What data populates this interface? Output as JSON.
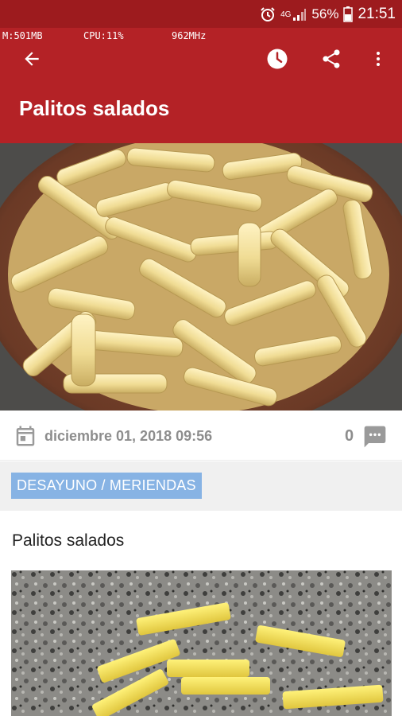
{
  "status_bar": {
    "debug": {
      "mem": "M:501MB",
      "cpu": "CPU:11%",
      "freq": "962MHz"
    },
    "network": "4G",
    "battery": "56%",
    "time": "21:51"
  },
  "toolbar": {
    "back_icon": "arrow-left-icon",
    "clock_icon": "clock-icon",
    "share_icon": "share-icon",
    "more_icon": "more-vertical-icon",
    "title": "Palitos salados"
  },
  "hero": {
    "alt": "Bowl of salty sticks"
  },
  "meta": {
    "date": "diciembre 01, 2018 09:56",
    "comments": "0",
    "calendar_icon": "calendar-icon",
    "comment_icon": "comment-icon"
  },
  "category": {
    "label": "DESAYUNO / MERIENDAS"
  },
  "post": {
    "text": "Palitos salados"
  },
  "colors": {
    "status_bar": "#9d1b1e",
    "toolbar": "#b42226",
    "chip": "#87b3e4",
    "meta_text": "#8d8d8d"
  }
}
